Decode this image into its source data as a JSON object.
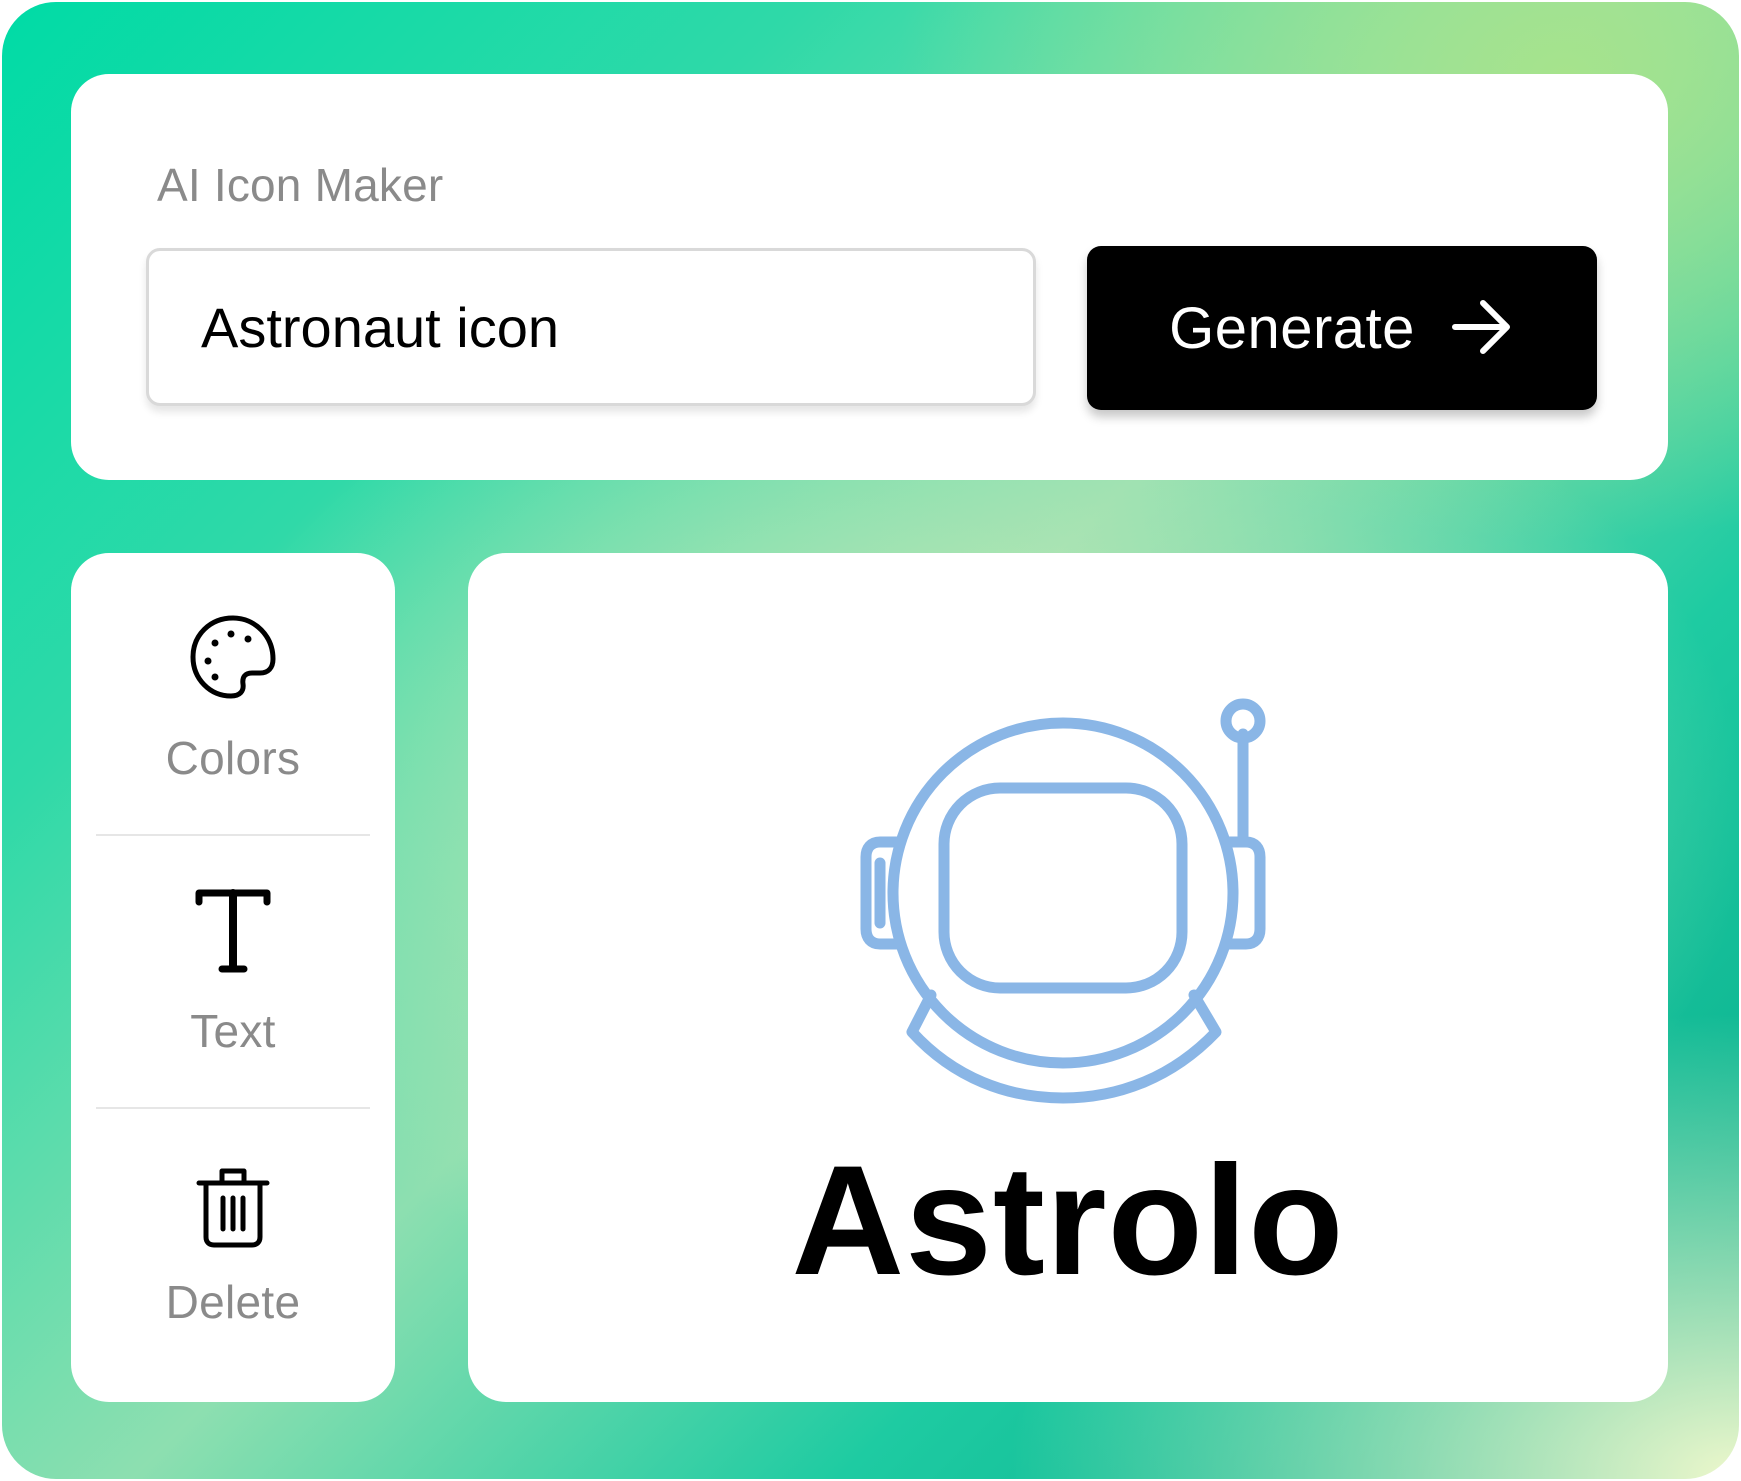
{
  "header": {
    "title": "AI Icon Maker"
  },
  "prompt": {
    "value": "Astronaut icon",
    "placeholder": ""
  },
  "generate": {
    "label": "Generate",
    "icon": "arrow-right-icon"
  },
  "tools": [
    {
      "label": "Colors",
      "icon": "palette-icon"
    },
    {
      "label": "Text",
      "icon": "text-icon"
    },
    {
      "label": "Delete",
      "icon": "trash-icon"
    }
  ],
  "preview": {
    "icon": "astronaut-helmet-icon",
    "icon_color": "#8ab6e6",
    "brand_name": "Astrolo"
  },
  "colors": {
    "accent_button": "#000000",
    "muted_text": "#8a8a8a",
    "background_gradient": [
      "#00dba6",
      "#a6e38c",
      "#eef8cc",
      "#05a888"
    ]
  }
}
